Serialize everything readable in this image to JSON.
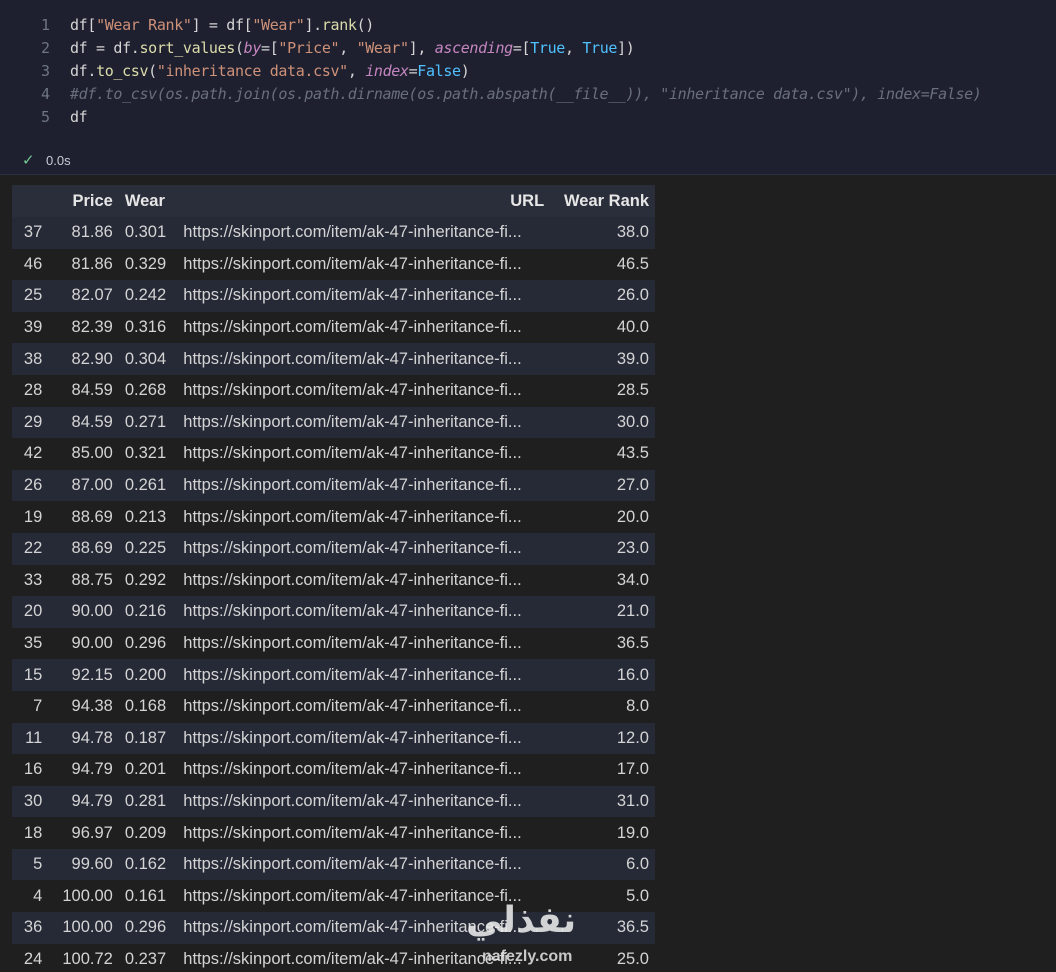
{
  "code_cell": {
    "lines": [
      {
        "no": "1",
        "tokens": [
          {
            "t": "df",
            "c": "t-id"
          },
          {
            "t": "[",
            "c": "t-op"
          },
          {
            "t": "\"Wear Rank\"",
            "c": "t-str"
          },
          {
            "t": "] = ",
            "c": "t-op"
          },
          {
            "t": "df",
            "c": "t-id"
          },
          {
            "t": "[",
            "c": "t-op"
          },
          {
            "t": "\"Wear\"",
            "c": "t-str"
          },
          {
            "t": "].",
            "c": "t-op"
          },
          {
            "t": "rank",
            "c": "t-fn"
          },
          {
            "t": "()",
            "c": "t-op"
          }
        ]
      },
      {
        "no": "2",
        "tokens": [
          {
            "t": "df",
            "c": "t-id"
          },
          {
            "t": " = ",
            "c": "t-op"
          },
          {
            "t": "df",
            "c": "t-id"
          },
          {
            "t": ".",
            "c": "t-op"
          },
          {
            "t": "sort_values",
            "c": "t-fn"
          },
          {
            "t": "(",
            "c": "t-op"
          },
          {
            "t": "by",
            "c": "t-kw"
          },
          {
            "t": "=[",
            "c": "t-op"
          },
          {
            "t": "\"Price\"",
            "c": "t-str"
          },
          {
            "t": ", ",
            "c": "t-op"
          },
          {
            "t": "\"Wear\"",
            "c": "t-str"
          },
          {
            "t": "], ",
            "c": "t-op"
          },
          {
            "t": "ascending",
            "c": "t-kw"
          },
          {
            "t": "=[",
            "c": "t-op"
          },
          {
            "t": "True",
            "c": "t-const"
          },
          {
            "t": ", ",
            "c": "t-op"
          },
          {
            "t": "True",
            "c": "t-const"
          },
          {
            "t": "])",
            "c": "t-op"
          }
        ]
      },
      {
        "no": "3",
        "tokens": [
          {
            "t": "df",
            "c": "t-id"
          },
          {
            "t": ".",
            "c": "t-op"
          },
          {
            "t": "to_csv",
            "c": "t-fn"
          },
          {
            "t": "(",
            "c": "t-op"
          },
          {
            "t": "\"inheritance data.csv\"",
            "c": "t-str"
          },
          {
            "t": ", ",
            "c": "t-op"
          },
          {
            "t": "index",
            "c": "t-kw"
          },
          {
            "t": "=",
            "c": "t-op"
          },
          {
            "t": "False",
            "c": "t-const"
          },
          {
            "t": ")",
            "c": "t-op"
          }
        ]
      },
      {
        "no": "4",
        "tokens": [
          {
            "t": "#df.to_csv(os.path.join(os.path.dirname(os.path.abspath(__file__)), \"inheritance data.csv\"), index=False)",
            "c": "t-comment"
          }
        ]
      },
      {
        "no": "5",
        "tokens": [
          {
            "t": "df",
            "c": "t-id"
          }
        ]
      }
    ],
    "status": {
      "icon": "check-icon",
      "time": "0.0s"
    }
  },
  "table": {
    "columns": [
      "",
      "Price",
      "Wear",
      "URL",
      "Wear Rank"
    ],
    "rows": [
      [
        "37",
        "81.86",
        "0.301",
        "https://skinport.com/item/ak-47-inheritance-fi...",
        "38.0"
      ],
      [
        "46",
        "81.86",
        "0.329",
        "https://skinport.com/item/ak-47-inheritance-fi...",
        "46.5"
      ],
      [
        "25",
        "82.07",
        "0.242",
        "https://skinport.com/item/ak-47-inheritance-fi...",
        "26.0"
      ],
      [
        "39",
        "82.39",
        "0.316",
        "https://skinport.com/item/ak-47-inheritance-fi...",
        "40.0"
      ],
      [
        "38",
        "82.90",
        "0.304",
        "https://skinport.com/item/ak-47-inheritance-fi...",
        "39.0"
      ],
      [
        "28",
        "84.59",
        "0.268",
        "https://skinport.com/item/ak-47-inheritance-fi...",
        "28.5"
      ],
      [
        "29",
        "84.59",
        "0.271",
        "https://skinport.com/item/ak-47-inheritance-fi...",
        "30.0"
      ],
      [
        "42",
        "85.00",
        "0.321",
        "https://skinport.com/item/ak-47-inheritance-fi...",
        "43.5"
      ],
      [
        "26",
        "87.00",
        "0.261",
        "https://skinport.com/item/ak-47-inheritance-fi...",
        "27.0"
      ],
      [
        "19",
        "88.69",
        "0.213",
        "https://skinport.com/item/ak-47-inheritance-fi...",
        "20.0"
      ],
      [
        "22",
        "88.69",
        "0.225",
        "https://skinport.com/item/ak-47-inheritance-fi...",
        "23.0"
      ],
      [
        "33",
        "88.75",
        "0.292",
        "https://skinport.com/item/ak-47-inheritance-fi...",
        "34.0"
      ],
      [
        "20",
        "90.00",
        "0.216",
        "https://skinport.com/item/ak-47-inheritance-fi...",
        "21.0"
      ],
      [
        "35",
        "90.00",
        "0.296",
        "https://skinport.com/item/ak-47-inheritance-fi...",
        "36.5"
      ],
      [
        "15",
        "92.15",
        "0.200",
        "https://skinport.com/item/ak-47-inheritance-fi...",
        "16.0"
      ],
      [
        "7",
        "94.38",
        "0.168",
        "https://skinport.com/item/ak-47-inheritance-fi...",
        "8.0"
      ],
      [
        "11",
        "94.78",
        "0.187",
        "https://skinport.com/item/ak-47-inheritance-fi...",
        "12.0"
      ],
      [
        "16",
        "94.79",
        "0.201",
        "https://skinport.com/item/ak-47-inheritance-fi...",
        "17.0"
      ],
      [
        "30",
        "94.79",
        "0.281",
        "https://skinport.com/item/ak-47-inheritance-fi...",
        "31.0"
      ],
      [
        "18",
        "96.97",
        "0.209",
        "https://skinport.com/item/ak-47-inheritance-fi...",
        "19.0"
      ],
      [
        "5",
        "99.60",
        "0.162",
        "https://skinport.com/item/ak-47-inheritance-fi...",
        "6.0"
      ],
      [
        "4",
        "100.00",
        "0.161",
        "https://skinport.com/item/ak-47-inheritance-fi...",
        "5.0"
      ],
      [
        "36",
        "100.00",
        "0.296",
        "https://skinport.com/item/ak-47-inheritance-fi...",
        "36.5"
      ],
      [
        "24",
        "100.72",
        "0.237",
        "https://skinport.com/item/ak-47-inheritance-fi...",
        "25.0"
      ]
    ]
  },
  "watermark": {
    "logo": "نفذلي",
    "site": "nafezly.com"
  }
}
